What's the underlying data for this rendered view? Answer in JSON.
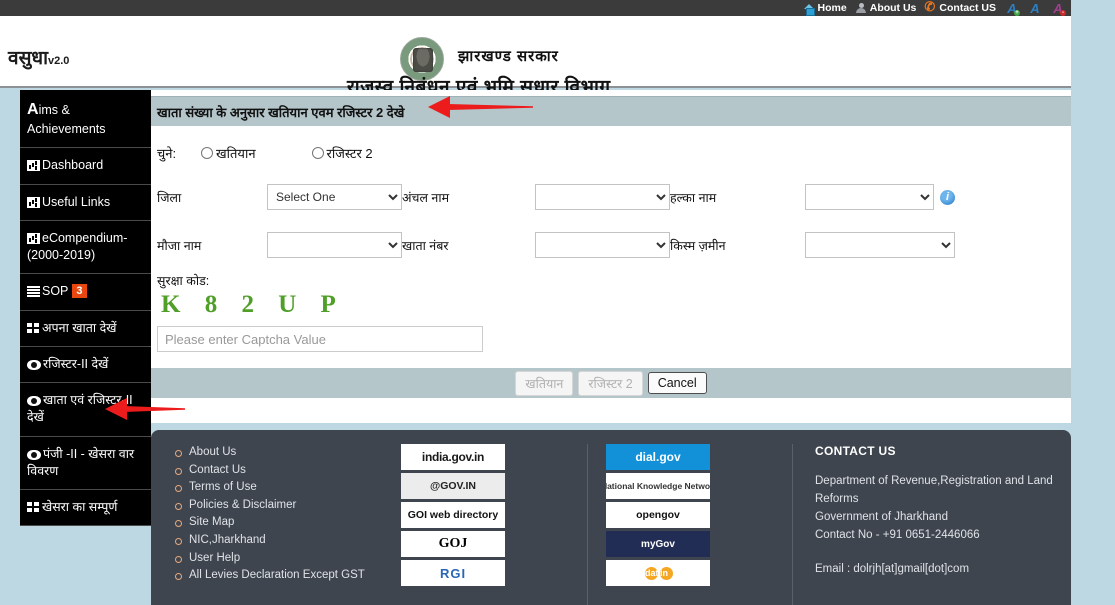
{
  "topbar": {
    "links": [
      {
        "label": "Home",
        "icon": "home-icon"
      },
      {
        "label": "About Us",
        "icon": "user-icon"
      },
      {
        "label": "Contact US",
        "icon": "phone-icon"
      }
    ],
    "font_controls": [
      {
        "label": "A",
        "name": "font-increase"
      },
      {
        "label": "A",
        "name": "font-normal"
      },
      {
        "label": "A",
        "name": "font-decrease"
      }
    ]
  },
  "banner": {
    "brand": "वसुधा",
    "brand_version": "v2.0",
    "gov_name": "झारखण्ड  सरकार",
    "dept_name": "राजस्व,निबंधन एवं भूमि सुधार  विभाग"
  },
  "sidebar": {
    "items": [
      {
        "label_lead": "A",
        "label": "ims & Achievements",
        "icon": "letter-a-icon"
      },
      {
        "label": "Dashboard",
        "icon": "chart-icon"
      },
      {
        "label": "Useful Links",
        "icon": "chart-icon"
      },
      {
        "label": "eCompendium-(2000-2019)",
        "icon": "chart-icon"
      },
      {
        "label": "SOP",
        "icon": "lines-icon",
        "badge": "3"
      },
      {
        "label": "अपना खाता देखें",
        "icon": "list-icon"
      },
      {
        "label": "रजिस्टर-II देखें",
        "icon": "eye-icon"
      },
      {
        "label": "खाता एवं रजिस्टर-II देखें",
        "icon": "eye-icon"
      },
      {
        "label": "पंजी -II - खेसरा वार विवरण",
        "icon": "eye-icon"
      },
      {
        "label": "खेसरा का सम्पूर्ण",
        "icon": "list-icon"
      }
    ]
  },
  "panel": {
    "title": "खाता संख्या के अनुसार खतियान एवम रजिस्टर 2 देखे",
    "choose_label": "चुने:",
    "radio_options": [
      {
        "label": "खतियान"
      },
      {
        "label": "रजिस्टर 2"
      }
    ],
    "fields": [
      {
        "label": "जिला",
        "value": "Select One",
        "name": "district-select"
      },
      {
        "label": "अंचल नाम",
        "value": "",
        "name": "circle-select"
      },
      {
        "label": "हल्का नाम",
        "value": "",
        "name": "halka-select"
      },
      {
        "label": "मौजा नाम",
        "value": "",
        "name": "mauja-select"
      },
      {
        "label": "खाता नंबर",
        "value": "",
        "name": "khata-number-select"
      },
      {
        "label": "किस्म ज़मीन",
        "value": "",
        "name": "land-type-select"
      }
    ],
    "info_icon_label": "i",
    "captcha_label": "सुरक्षा कोड:",
    "captcha_code": "K 8 2 U P",
    "captcha_placeholder": "Please enter Captcha Value",
    "captcha_value": "",
    "buttons": [
      {
        "label": "खतियान",
        "state": "disabled",
        "name": "khatiyan-button"
      },
      {
        "label": "रजिस्टर 2",
        "state": "disabled",
        "name": "register2-button"
      },
      {
        "label": "Cancel",
        "state": "enabled",
        "name": "cancel-button"
      }
    ]
  },
  "footer": {
    "links": [
      "About Us",
      "Contact Us",
      "Terms of Use",
      "Policies & Disclaimer",
      "Site Map",
      "NIC,Jharkhand",
      "User Help",
      "All Levies Declaration Except GST"
    ],
    "logos_col1": [
      {
        "name": "india-gov-in-logo",
        "text": "india.gov.in"
      },
      {
        "name": "at-gov-in-logo",
        "text": "@GOV.IN"
      },
      {
        "name": "goi-web-directory-logo",
        "text": "GOI web directory"
      },
      {
        "name": "goj-logo",
        "text": "GOJ"
      },
      {
        "name": "rgi-logo",
        "text": "RGI"
      }
    ],
    "logos_col2": [
      {
        "name": "dial-gov-logo",
        "text": "dial.gov"
      },
      {
        "name": "national-knowledge-network-logo",
        "text": "National Knowledge Network"
      },
      {
        "name": "opengov-logo",
        "text": "opengov"
      },
      {
        "name": "mygov-logo",
        "text": "myGov"
      },
      {
        "name": "data-gov-in-logo",
        "text": "data.gov"
      }
    ],
    "contact": {
      "heading": "CONTACT US",
      "line1": "Department of Revenue,Registration and Land",
      "line2": "Reforms",
      "line3": "Government of Jharkhand",
      "line4": "Contact No - +91 0651-2446066",
      "email": "Email : dolrjh[at]gmail[dot]com"
    }
  },
  "colors": {
    "page_background": "#bdd7e3",
    "topbar": "#3b3b3b",
    "sidebar": "#000000",
    "panel_header": "#b5c6cb",
    "footer": "#3f454e",
    "captcha_text": "#4f9f29",
    "badge": "#e8470f",
    "annotation_arrow": "#ec1c1c"
  }
}
